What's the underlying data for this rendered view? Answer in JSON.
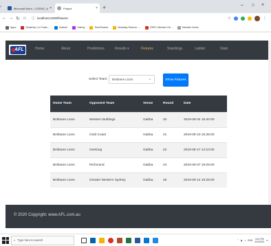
{
  "browser": {
    "tabs": [
      {
        "title": "Microsoft Word - COENG_Assi",
        "active": false,
        "icon": "word-icon",
        "color": "#2b579a"
      },
      {
        "title": "Project",
        "active": true,
        "icon": "globe-icon",
        "color": "#5f6368"
      }
    ],
    "new_tab": "+",
    "window_controls": {
      "minimize": "–",
      "maximize": "□",
      "close": "×"
    },
    "url": "localhost:4200/fixtures",
    "bookmarks": [
      {
        "label": "Apps",
        "color": "#5f6368"
      },
      {
        "label": "Students | Le Frabe...",
        "color": "#c62828"
      },
      {
        "label": "Outlook",
        "color": "#0078d4"
      },
      {
        "label": "Udemy",
        "color": "#a435f0"
      },
      {
        "label": "TennRuckes",
        "color": "#f4b400"
      },
      {
        "label": "Workday Tekever -...",
        "color": "#f4b400"
      },
      {
        "label": "RPEC Member Re...",
        "color": "#d93025"
      },
      {
        "label": "Member Home",
        "color": "#9e9e9e"
      }
    ]
  },
  "navbar": {
    "logo_text": "AFL",
    "links": [
      "Home",
      "About",
      "Predictions",
      "Results ▾",
      "Fixtures",
      "Standings",
      "Ladder",
      "Stats"
    ],
    "active": "Fixtures",
    "active_color": "#f0ad4e"
  },
  "filter": {
    "label": "Select Team:",
    "selected": "Brisbane Lions",
    "button": "Show Fixtures"
  },
  "table": {
    "headers": [
      "Home Team",
      "Opponent Team",
      "Venue",
      "Round",
      "Date"
    ],
    "rows": [
      [
        "Brisbane Lions",
        "Western Bulldogs",
        "Gabba",
        "20",
        "2019-08-04 16:40:00"
      ],
      [
        "Brisbane Lions",
        "Gold Coast",
        "Gabba",
        "21",
        "2019-08-10 16:35:00"
      ],
      [
        "Brisbane Lions",
        "Geelong",
        "Gabba",
        "22",
        "2019-08-17 14:10:00"
      ],
      [
        "Brisbane Lions",
        "Richmond",
        "Gabba",
        "24",
        "2019-09-07 19:25:00"
      ],
      [
        "Brisbane Lions",
        "Greater Western Sydney",
        "Gabba",
        "25",
        "2019-09-14 19:25:00"
      ]
    ]
  },
  "footer": {
    "text": "© 2020 Copyright: www.AFL.com.au"
  },
  "taskbar": {
    "search_placeholder": "Type here to search",
    "apps": [
      "#0063b1",
      "#2b579a",
      "#f4b400",
      "#d93025",
      "#217346",
      "#2b579a",
      "#0078d4",
      "#1e88e5",
      "#b7472a"
    ],
    "tray_lang": "ENG",
    "tray_time": "4:41 PM",
    "tray_date": "6/1/2020"
  }
}
